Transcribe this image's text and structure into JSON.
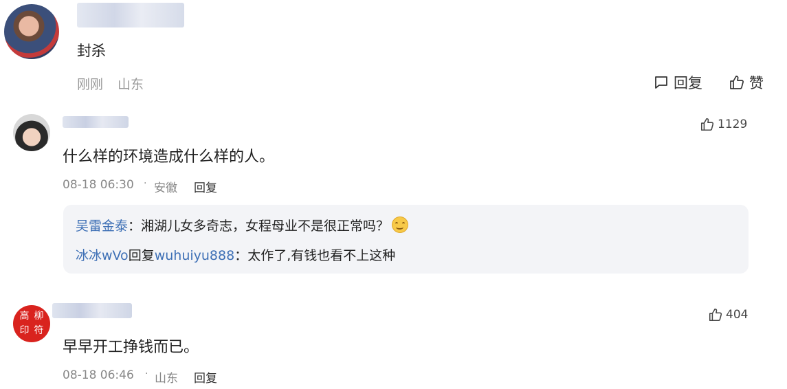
{
  "top_comment": {
    "text": "封杀",
    "time": "刚刚",
    "location": "山东",
    "reply_label": "回复",
    "like_label": "赞"
  },
  "comments": [
    {
      "text": "什么样的环境造成什么样的人。",
      "time": "08-18 06:30",
      "separator": "·",
      "location": "安徽",
      "reply_label": "回复",
      "likes": "1129",
      "replies": [
        {
          "user": "吴雷金泰",
          "colon": "：",
          "text": "湘湖儿女多奇志，女程母业不是很正常吗？",
          "emoji": "smile-emoji"
        },
        {
          "user": "冰冰wVo",
          "reply_word": "回复",
          "target": "wuhuiyu888",
          "colon": "：",
          "text": "太作了,有钱也看不上这种"
        }
      ]
    },
    {
      "text": "早早开工挣钱而已。",
      "time": "08-18 06:46",
      "separator": "·",
      "location": "山东",
      "reply_label": "回复",
      "likes": "404",
      "avatar_seal": "高柳印符"
    }
  ],
  "colors": {
    "link_blue": "#3d6fb5",
    "seal_red": "#d9231e",
    "subbox_bg": "#f3f4f7"
  }
}
